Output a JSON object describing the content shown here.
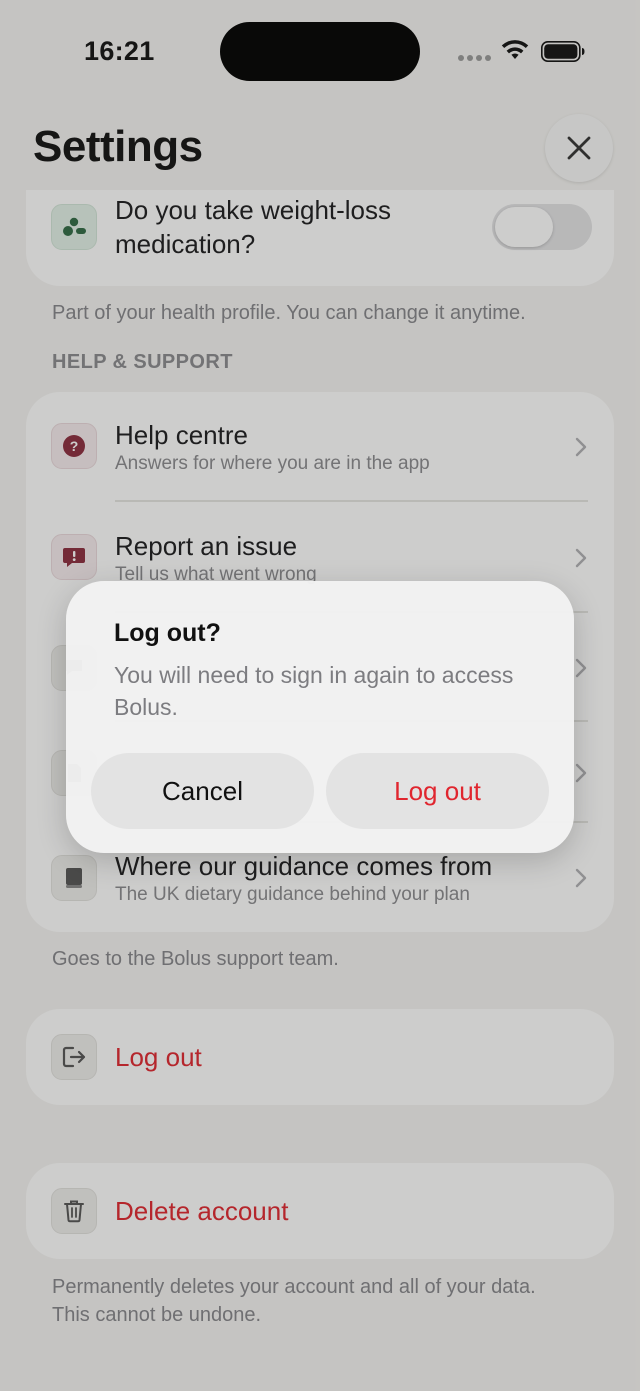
{
  "status_bar": {
    "time": "16:21"
  },
  "header": {
    "title": "Settings"
  },
  "medication": {
    "question": "Do you take weight-loss medication?",
    "toggle_on": false,
    "footnote": "Part of your health profile. You can change it anytime."
  },
  "help_support": {
    "section_title": "HELP & SUPPORT",
    "items": [
      {
        "title": "Help centre",
        "subtitle": "Answers for where you are in the app",
        "icon": "question-icon"
      },
      {
        "title": "Report an issue",
        "subtitle": "Tell us what went wrong",
        "icon": "report-icon"
      },
      {
        "icon": "chat-icon"
      },
      {
        "icon": "document-icon"
      },
      {
        "title": "Where our guidance comes from",
        "subtitle": "The UK dietary guidance behind your plan",
        "icon": "book-icon"
      }
    ],
    "footnote": "Goes to the Bolus support team."
  },
  "logout": {
    "label": "Log out",
    "icon": "logout-icon"
  },
  "delete_account": {
    "label": "Delete account",
    "icon": "trash-icon",
    "footnote_line1": "Permanently deletes your account and all of your data.",
    "footnote_line2": "This cannot be undone."
  },
  "dialog": {
    "title": "Log out?",
    "message": "You will need to sign in again to access Bolus.",
    "cancel_label": "Cancel",
    "confirm_label": "Log out"
  },
  "colors": {
    "destructive": "#e0262f",
    "background": "#f5f4f2",
    "card": "#ffffff"
  }
}
